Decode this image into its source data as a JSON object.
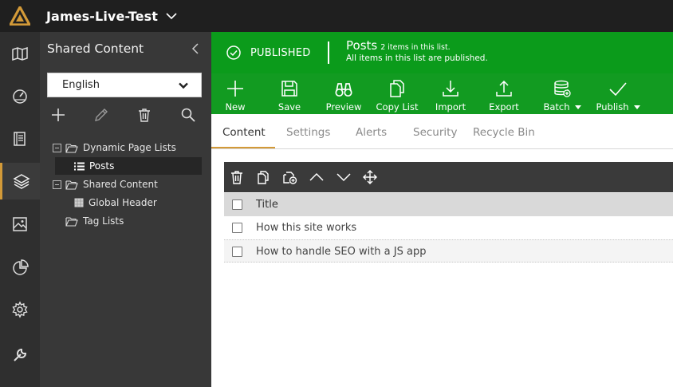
{
  "app": {
    "site_title": "James-Live-Test",
    "accent_color": "#d39a38",
    "icons": [
      "logo-icon",
      "chevron-down-icon"
    ]
  },
  "rail": {
    "items": [
      {
        "name": "map-icon"
      },
      {
        "name": "dashboard-icon"
      },
      {
        "name": "pages-icon"
      },
      {
        "name": "layers-icon",
        "active": true
      },
      {
        "name": "image-icon"
      },
      {
        "name": "pie-chart-icon"
      },
      {
        "name": "gear-icon"
      },
      {
        "name": "wrench-icon"
      }
    ]
  },
  "tree": {
    "title": "Shared Content",
    "language": "English",
    "tools": [
      "plus-icon",
      "pencil-icon",
      "trash-icon",
      "search-icon"
    ],
    "nodes": [
      {
        "label": "Dynamic Page Lists",
        "icon": "folder-open-icon",
        "expander": "minus-icon"
      },
      {
        "label": "Posts",
        "icon": "list-icon",
        "selected": true
      },
      {
        "label": "Shared Content",
        "icon": "folder-open-icon",
        "expander": "minus-icon"
      },
      {
        "label": "Global Header",
        "icon": "grid-icon"
      },
      {
        "label": "Tag Lists",
        "icon": "folder-open-icon"
      }
    ]
  },
  "status": {
    "state": "PUBLISHED",
    "list_name": "Posts",
    "list_count": "2 items in this list.",
    "list_sub": "All items in this list are published.",
    "color": "#0b9b1b"
  },
  "toolbar": {
    "buttons": [
      {
        "label": "New",
        "icon": "plus-icon"
      },
      {
        "label": "Save",
        "icon": "save-icon"
      },
      {
        "label": "Preview",
        "icon": "binoculars-icon"
      },
      {
        "label": "Copy List",
        "icon": "copy-icon"
      },
      {
        "label": "Import",
        "icon": "import-icon"
      },
      {
        "label": "Export",
        "icon": "export-icon"
      },
      {
        "label": "Batch",
        "icon": "database-icon",
        "dropdown": true
      },
      {
        "label": "Publish",
        "icon": "check-icon",
        "dropdown": true
      }
    ]
  },
  "tabs": [
    {
      "label": "Content",
      "active": true
    },
    {
      "label": "Settings"
    },
    {
      "label": "Alerts"
    },
    {
      "label": "Security"
    },
    {
      "label": "Recycle Bin"
    }
  ],
  "grid": {
    "tools": [
      "trash-icon",
      "copy-icon",
      "add-copy-icon",
      "chevron-up-icon",
      "chevron-down-icon",
      "move-icon"
    ],
    "columns": [
      "Title"
    ],
    "rows": [
      {
        "title": "How this site works"
      },
      {
        "title": "How to handle SEO with a JS app"
      }
    ]
  }
}
